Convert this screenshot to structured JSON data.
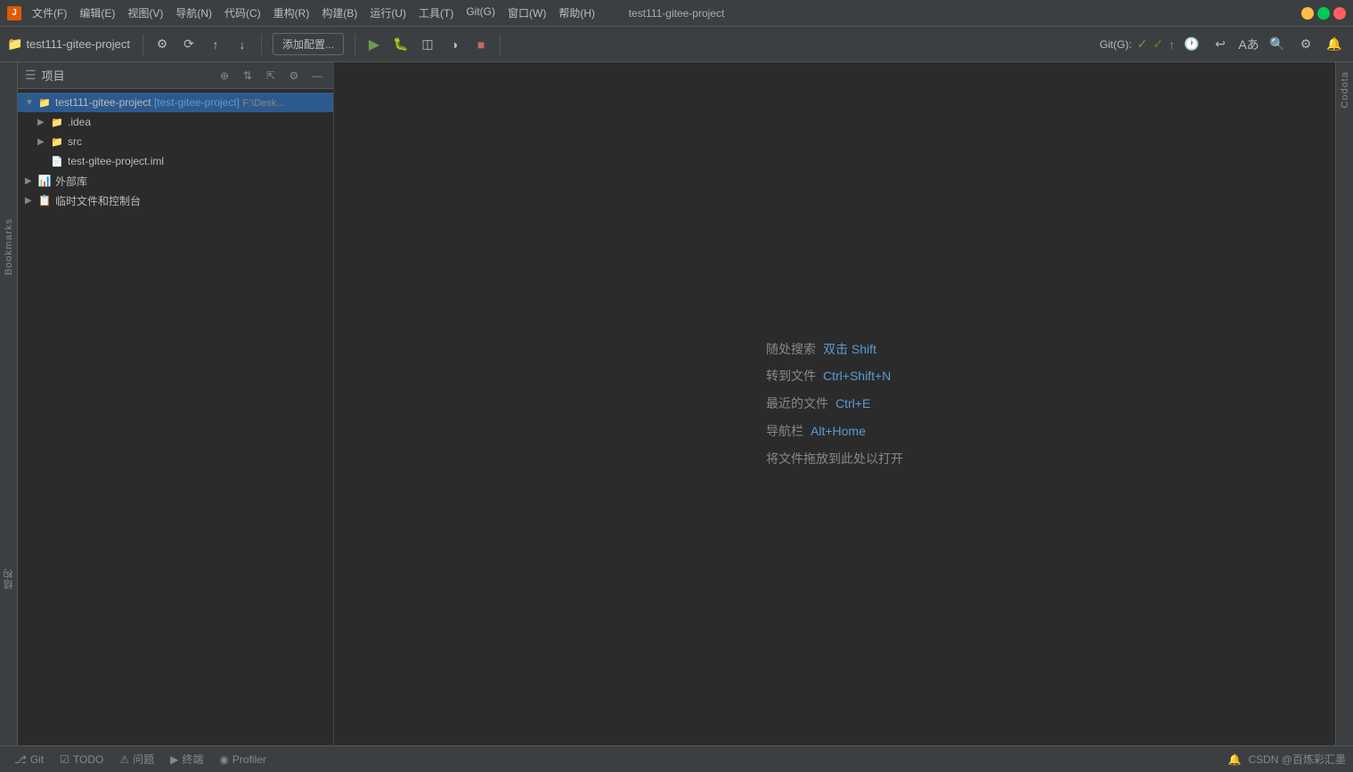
{
  "titlebar": {
    "app_icon_label": "J",
    "menu_items": [
      "文件(F)",
      "编辑(E)",
      "视图(V)",
      "导航(N)",
      "代码(C)",
      "重构(R)",
      "构建(B)",
      "运行(U)",
      "工具(T)",
      "Git(G)",
      "窗口(W)",
      "帮助(H)"
    ],
    "window_title": "test111-gitee-project",
    "controls": [
      "_",
      "□",
      "✕"
    ]
  },
  "toolbar": {
    "project_name": "test111-gitee-project",
    "add_config_label": "添加配置...",
    "git_label": "Git(G):"
  },
  "project_panel": {
    "title": "项目",
    "root_item": {
      "name": "test111-gitee-project",
      "bracket_name": "[test-gitee-project]",
      "path": "F:\\Desk..."
    },
    "items": [
      {
        "indent": 1,
        "type": "folder",
        "name": ".idea",
        "expanded": false
      },
      {
        "indent": 1,
        "type": "folder-src",
        "name": "src",
        "expanded": false
      },
      {
        "indent": 1,
        "type": "iml",
        "name": "test-gitee-project.iml"
      },
      {
        "indent": 0,
        "type": "lib",
        "name": "外部库",
        "expanded": false
      },
      {
        "indent": 0,
        "type": "scratch",
        "name": "临时文件和控制台",
        "expanded": false
      }
    ]
  },
  "editor": {
    "hints": [
      {
        "label": "随处搜索",
        "key": "双击 Shift"
      },
      {
        "label": "转到文件",
        "key": "Ctrl+Shift+N"
      },
      {
        "label": "最近的文件",
        "key": "Ctrl+E"
      },
      {
        "label": "导航栏",
        "key": "Alt+Home"
      },
      {
        "label": "将文件拖放到此处以打开",
        "key": ""
      }
    ]
  },
  "bottom_bar": {
    "tabs": [
      {
        "icon": "⎇",
        "label": "Git"
      },
      {
        "icon": "☑",
        "label": "TODO"
      },
      {
        "icon": "⚠",
        "label": "问题"
      },
      {
        "icon": "▶",
        "label": "终端"
      },
      {
        "icon": "◉",
        "label": "Profiler"
      }
    ],
    "right_info": "CSDN @百炼彩汇墨"
  },
  "right_panel_labels": [
    "Codota"
  ],
  "left_panel_labels": [
    "Bookmarks",
    "结构"
  ]
}
